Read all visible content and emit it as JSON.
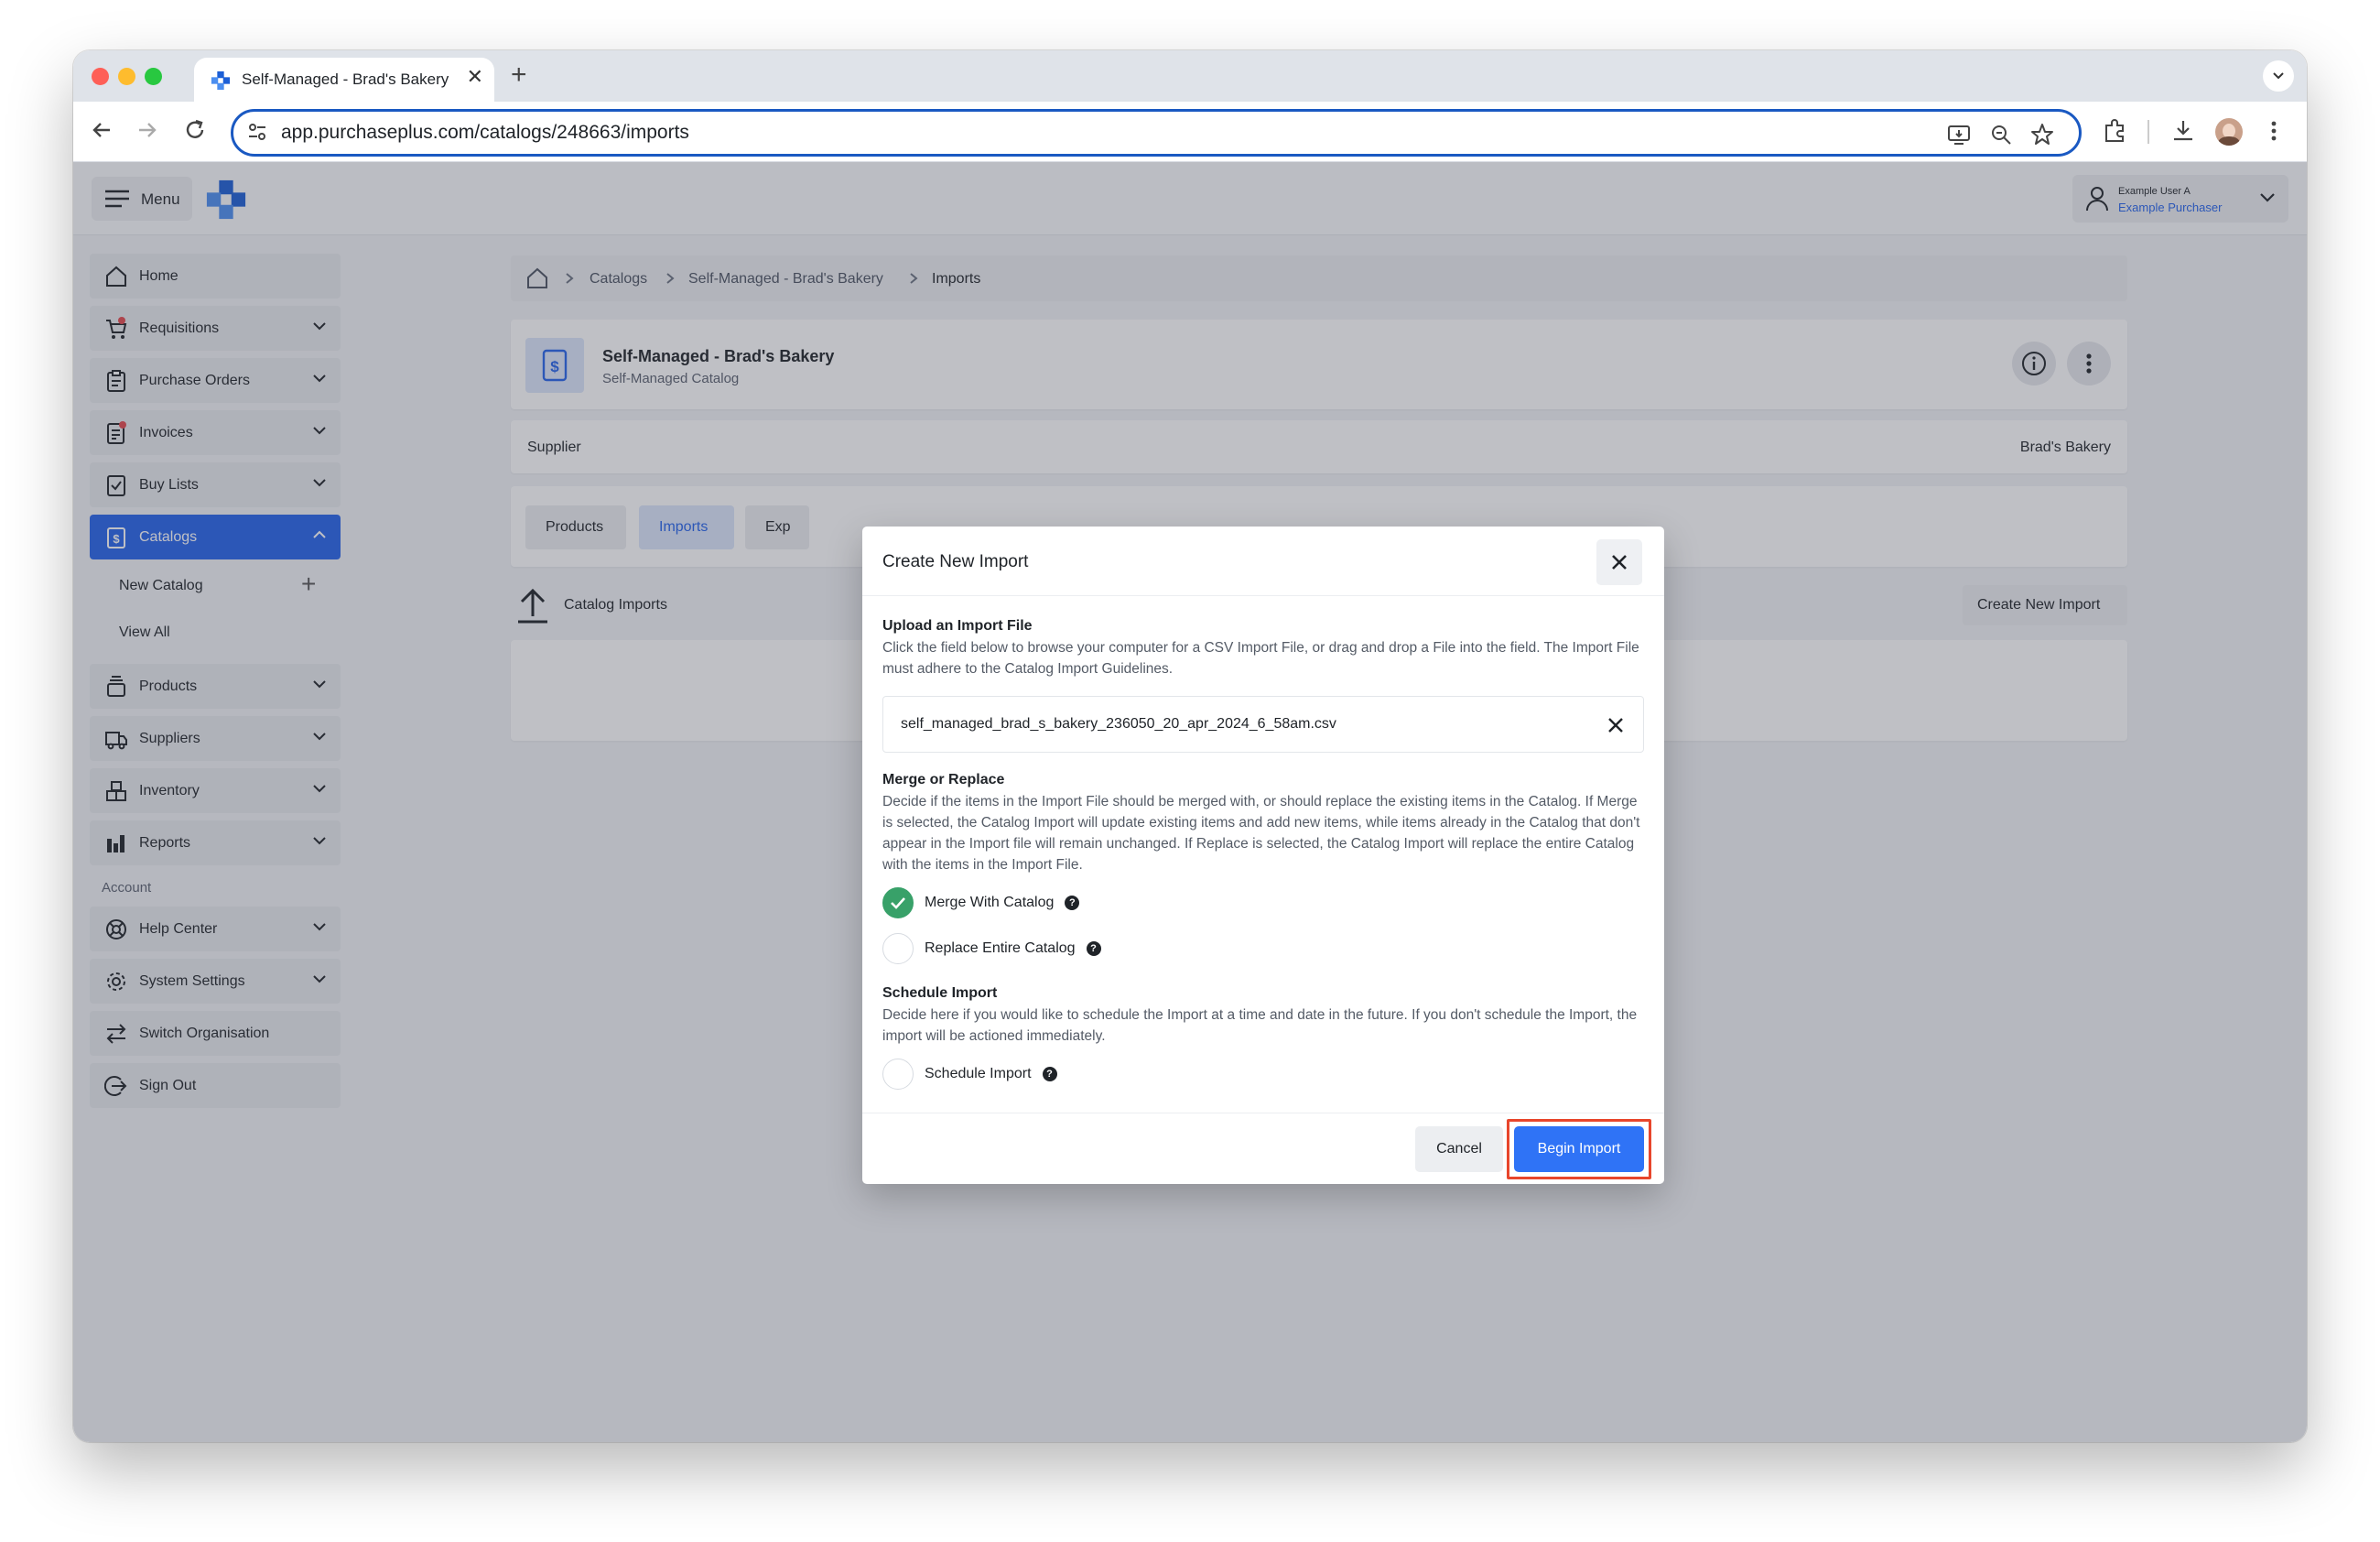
{
  "browser": {
    "tab_title": "Self-Managed - Brad's Bakery",
    "tab_close": "✕",
    "new_tab": "+",
    "url": "app.purchaseplus.com/catalogs/248663/imports"
  },
  "header": {
    "menu_label": "Menu",
    "user_name": "Example User A",
    "user_role": "Example Purchaser"
  },
  "sidebar": {
    "items": [
      {
        "label": "Home"
      },
      {
        "label": "Requisitions"
      },
      {
        "label": "Purchase Orders"
      },
      {
        "label": "Invoices"
      },
      {
        "label": "Buy Lists"
      },
      {
        "label": "Catalogs"
      },
      {
        "label": "Products"
      },
      {
        "label": "Suppliers"
      },
      {
        "label": "Inventory"
      },
      {
        "label": "Reports"
      }
    ],
    "catalog_sub": {
      "new_catalog": "New Catalog",
      "view_all": "View All",
      "add": "+"
    },
    "account_section": "Account",
    "account_items": [
      {
        "label": "Help Center"
      },
      {
        "label": "System Settings"
      },
      {
        "label": "Switch Organisation"
      },
      {
        "label": "Sign Out"
      }
    ]
  },
  "breadcrumb": {
    "items": [
      "Catalogs",
      "Self-Managed - Brad's Bakery",
      "Imports"
    ]
  },
  "catalog": {
    "title": "Self-Managed - Brad's Bakery",
    "subtitle": "Self-Managed Catalog",
    "supplier_label": "Supplier",
    "supplier_value": "Brad's Bakery"
  },
  "tabs": {
    "products": "Products",
    "imports": "Imports",
    "exports": "Exp"
  },
  "imports_section": {
    "title": "Catalog Imports",
    "create_button": "Create New Import"
  },
  "modal": {
    "title": "Create New Import",
    "upload_title": "Upload an Import File",
    "upload_desc": "Click the field below to browse your computer for a CSV Import File, or drag and drop a File into the field. The Import File must adhere to the Catalog Import Guidelines.",
    "file_name": "self_managed_brad_s_bakery_236050_20_apr_2024_6_58am.csv",
    "merge_title": "Merge or Replace",
    "merge_desc": "Decide if the items in the Import File should be merged with, or should replace the existing items in the Catalog. If Merge is selected, the Catalog Import will update existing items and add new items, while items already in the Catalog that don't appear in the Import file will remain unchanged. If Replace is selected, the Catalog Import will replace the entire Catalog with the items in the Import File.",
    "merge_option": "Merge With Catalog",
    "replace_option": "Replace Entire Catalog",
    "schedule_title": "Schedule Import",
    "schedule_desc": "Decide here if you would like to schedule the Import at a time and date in the future. If you don't schedule the Import, the import will be actioned immediately.",
    "schedule_option": "Schedule Import",
    "help_glyph": "?",
    "cancel": "Cancel",
    "begin": "Begin Import"
  },
  "colors": {
    "accent": "#2563eb",
    "begin_button": "#2f73f6",
    "checked_green": "#38a169",
    "highlight_red": "#e8462c"
  }
}
